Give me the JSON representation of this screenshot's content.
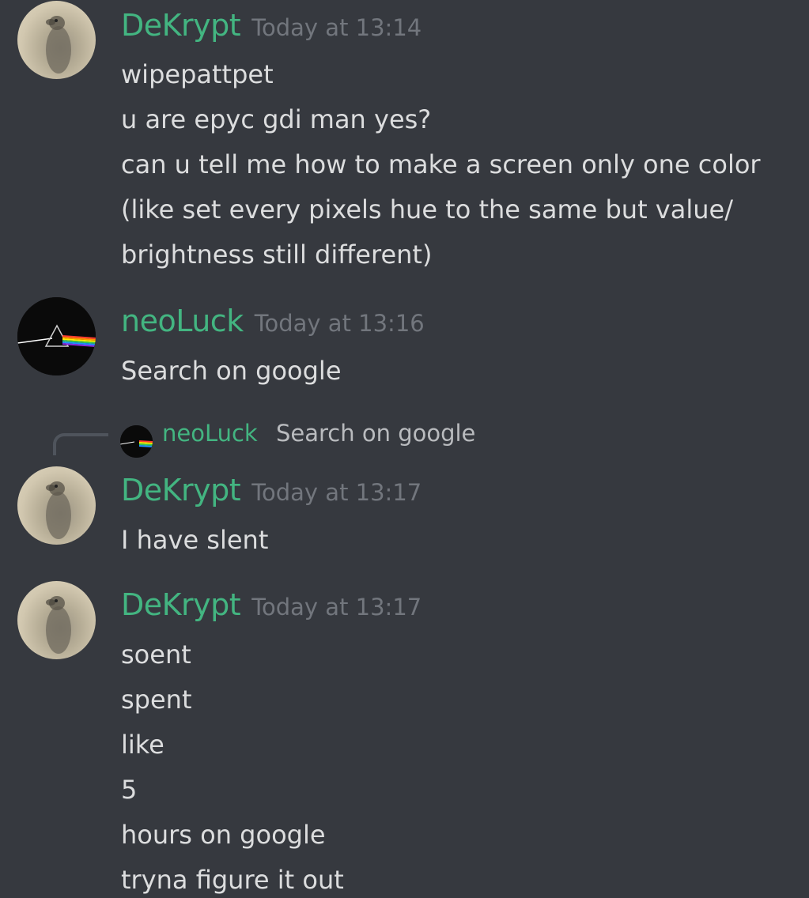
{
  "messages": [
    {
      "author": "DeKrypt",
      "timestamp": "Today at 13:14",
      "avatar": "meerkat-avatar",
      "lines": [
        "wipepattpet",
        "u are epyc gdi man yes?",
        "can u tell me how to make a screen only one color",
        "(like set every pixels hue to the same but value/",
        "brightness still different)"
      ]
    },
    {
      "author": "neoLuck",
      "timestamp": "Today at 13:16",
      "avatar": "prism-avatar",
      "lines": [
        "Search on google"
      ]
    },
    {
      "author": "DeKrypt",
      "timestamp": "Today at 13:17",
      "avatar": "meerkat-avatar",
      "reply_to": {
        "author": "neoLuck",
        "text": "Search on google"
      },
      "lines": [
        "I have slent"
      ]
    },
    {
      "author": "DeKrypt",
      "timestamp": "Today at 13:17",
      "avatar": "meerkat-avatar",
      "lines": [
        "soent",
        "spent",
        "like",
        "5",
        "hours on google",
        "tryna figure it out"
      ]
    }
  ],
  "colors": {
    "background": "#36393f",
    "username": "#43b581",
    "timestamp": "#72767d",
    "text": "#dcddde",
    "reply_line": "#4f545c"
  }
}
